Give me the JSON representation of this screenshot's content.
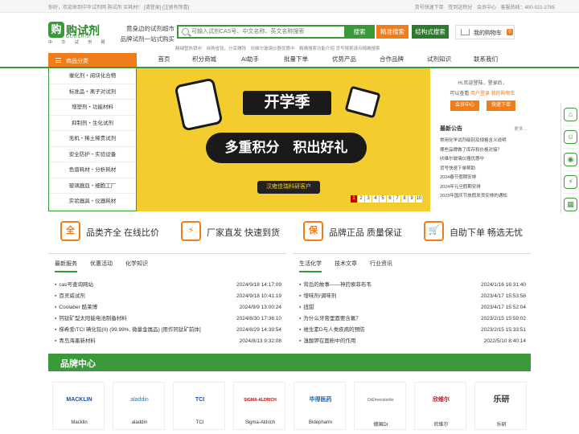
{
  "topbar": {
    "welcome": "你好，欢迎来到中华试剂网 购试剂 买耗材！ [请登录] [注册有惊喜]",
    "links": [
      "货号快速下单",
      "签到送积分",
      "会员中心",
      "客服热线：400-021-2765"
    ]
  },
  "header": {
    "logo_mark": "购",
    "logo_text": "购试剂",
    "logo_sub": "GOUSHIJI",
    "logo_cn": "中 华 试 剂 网",
    "slogan_line1": "竟身边的试剂超市",
    "slogan_line2": "品牌试剂一站式购买",
    "search_placeholder": "可输入试剂CAS号、中文名称、英文名称搜索",
    "search_label": "搜索",
    "precise_label": "精准搜索",
    "structure_label": "结构式搜索",
    "hot_text": "精细管热销中　自购省钱，分享赚钱　欣维尔玻璃仪器优惠中　精确搜索功能介绍 货号搜索请点精确搜索",
    "cart_label": "我的购物车",
    "cart_count": "0"
  },
  "nav": {
    "category_label": "商品分类",
    "items": [
      "首页",
      "积分商城",
      "AI助手",
      "批量下单",
      "优势产品",
      "合作品牌",
      "试剂知识",
      "联系我们"
    ]
  },
  "categories": [
    "催化剂・阅块化合物",
    "标准品・离子对试剂",
    "增塑剂・功能材料",
    "抑制剂・生化试剂",
    "无机・稀土稀贵试剂",
    "安全防护・实验设备",
    "色谱耗材・分析耗材",
    "玻璃器皿・细胞工厂",
    "实验器具・仪器耗材"
  ],
  "banner": {
    "title": "开学季",
    "subtitle": "多重积分　积出好礼",
    "tag": "汉雍佳瑞科研客户",
    "pages": [
      "1",
      "2",
      "3",
      "4",
      "5",
      "6",
      "7",
      "8",
      "9",
      "10"
    ],
    "active_page": 0
  },
  "user_panel": {
    "hi": "Hi,欢迎登陆，登录后，",
    "line2_prefix": "可以查看",
    "line2_link": "用户登录 我的购物车",
    "register_label": "会员中心",
    "quick_label": "快速下单"
  },
  "latest_news": {
    "title": "最新公告",
    "more": "更多...",
    "items": [
      "常用化学试剂级别及规格含义说明",
      "哪些品牌做了库存和价格对接？",
      "欣维尔玻璃仪器优惠中",
      "货号快速下单帮助",
      "2024春节假期安排",
      "2024年元旦假期安排",
      "2023年国庆节放假发货安排的通知"
    ]
  },
  "features": [
    {
      "icon": "全",
      "text": "品类齐全 在线比价"
    },
    {
      "icon": "⚡",
      "text": "厂家直发 快速到货"
    },
    {
      "icon": "保",
      "text": "品牌正品 质量保证"
    },
    {
      "icon": "🛒",
      "text": "自助下单 畅选无忧"
    }
  ],
  "panel_left": {
    "tabs": [
      "最新服务",
      "优惠活动",
      "化学知识"
    ],
    "rows": [
      {
        "title": "cas号查询网站",
        "date": "2024/9/18 14:17:09"
      },
      {
        "title": "百灵威试剂",
        "date": "2024/9/18 10:41:19"
      },
      {
        "title": "Coolaber 酷莱博",
        "date": "2024/9/9 13:00:24"
      },
      {
        "title": "钙钛矿型太阳能电池制备材料",
        "date": "2024/8/30 17:36:10"
      },
      {
        "title": "梯希爱/TCI 碘化铅(II) (99.99%, 微量金属品) [用作钙钛矿前体]",
        "date": "2024/8/29 14:39:54"
      },
      {
        "title": "青岛海墨新材料",
        "date": "2024/8/13 9:32:08"
      }
    ]
  },
  "panel_right": {
    "tabs": [
      "生活化学",
      "技术文章",
      "行业资讯"
    ],
    "rows": [
      {
        "title": "背后的故事——神药索菲布韦",
        "date": "2024/1/16 16:31:40"
      },
      {
        "title": "增味剂/调味剂",
        "date": "2023/4/17 15:53:58"
      },
      {
        "title": "扭甜",
        "date": "2023/4/17 15:52:04"
      },
      {
        "title": "为什么牙膏里面要含氟？",
        "date": "2023/2/15 15:59:02"
      },
      {
        "title": "维生素D与人类疾病的预防",
        "date": "2023/2/15 15:33:51"
      },
      {
        "title": "溴酸钾在面粉中的作用",
        "date": "2022/5/10 8:40:14"
      }
    ]
  },
  "brand_center": {
    "title": "品牌中心",
    "brands": [
      {
        "logo": "MACKLIN",
        "name": "Macklin"
      },
      {
        "logo": "aladdin",
        "name": "aladdin"
      },
      {
        "logo": "TCI",
        "name": "TCI"
      },
      {
        "logo": "SIGMA-ALDRICH",
        "name": "Sigma-Aldrich"
      },
      {
        "logo": "毕得医药",
        "name": "Bidepharm"
      },
      {
        "logo": "DrEhrenstorfer",
        "name": "德国Dr"
      },
      {
        "logo": "欣维尔",
        "name": "欣维尔"
      },
      {
        "logo": "乐研",
        "name": "乐研"
      }
    ]
  },
  "colors": {
    "brand_green": "#3a9a3a",
    "accent_orange": "#f07d1a",
    "banner_yellow": "#f3cd2e"
  }
}
